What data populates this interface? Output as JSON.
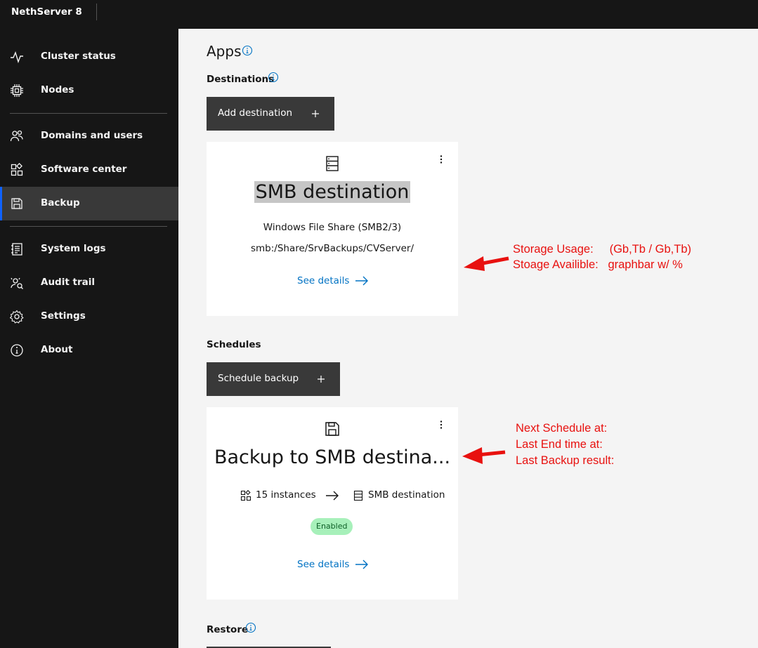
{
  "topbar": {
    "brand": "NethServer 8"
  },
  "sidebar": {
    "items": [
      {
        "label": "Cluster status",
        "icon": "activity-icon"
      },
      {
        "label": "Nodes",
        "icon": "chip-icon"
      },
      {
        "label": "Domains and users",
        "icon": "users-icon"
      },
      {
        "label": "Software center",
        "icon": "apps-icon"
      },
      {
        "label": "Backup",
        "icon": "save-icon",
        "active": true
      },
      {
        "label": "System logs",
        "icon": "logs-icon"
      },
      {
        "label": "Audit trail",
        "icon": "audit-icon"
      },
      {
        "label": "Settings",
        "icon": "gear-icon"
      },
      {
        "label": "About",
        "icon": "info-icon"
      }
    ]
  },
  "main": {
    "title": "Apps",
    "destinations": {
      "heading": "Destinations",
      "add_button": "Add destination",
      "card": {
        "title": "SMB destination",
        "type": "Windows File Share (SMB2/3)",
        "path": "smb:/Share/SrvBackups/CVServer/",
        "link": "See details"
      }
    },
    "schedules": {
      "heading": "Schedules",
      "add_button": "Schedule backup",
      "card": {
        "title": "Backup to SMB destina...",
        "instances": "15 instances",
        "destination": "SMB destination",
        "status": "Enabled",
        "link": "See details"
      }
    },
    "restore": {
      "heading": "Restore"
    }
  },
  "annotations": {
    "destination_note_line1": "Storage Usage:     (Gb,Tb / Gb,Tb)",
    "destination_note_line2": "Stoage Availible:   graphbar w/ %",
    "schedule_note_line1": "Next Schedule at:",
    "schedule_note_line2": "Last End time at:",
    "schedule_note_line3": "Last Backup result:",
    "color": "#e8110f"
  },
  "colors": {
    "accent": "#0f62fe",
    "link": "#0072c3",
    "sidebar_bg": "#161616",
    "enabled_tag": "#a7f0ba"
  }
}
